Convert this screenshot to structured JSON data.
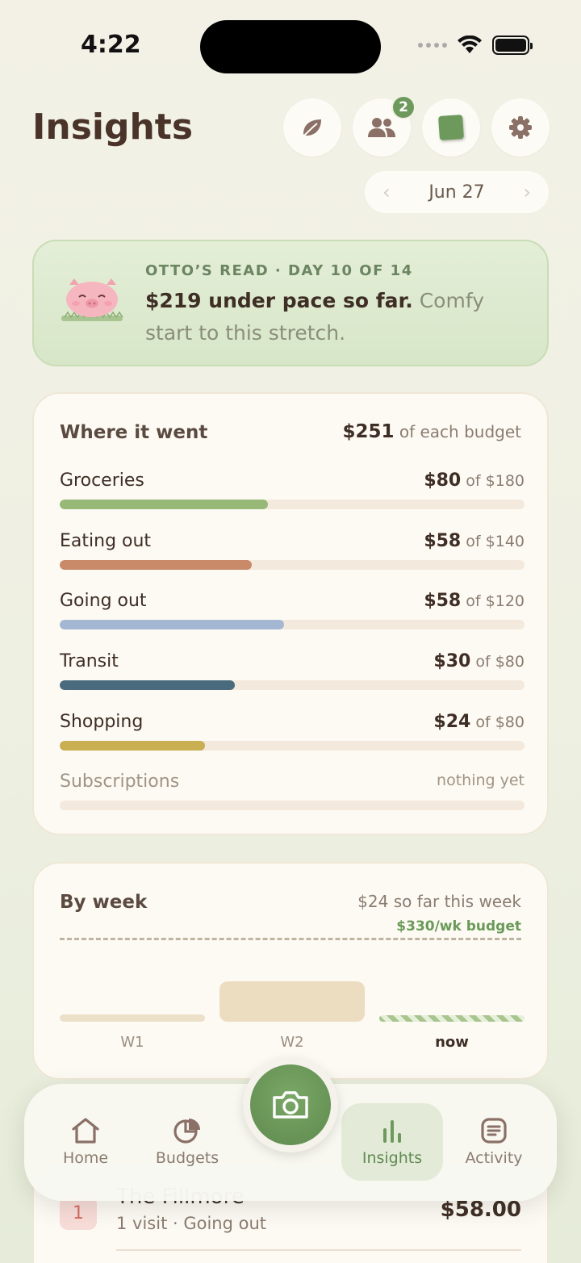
{
  "status": {
    "time": "4:22"
  },
  "header": {
    "title": "Insights",
    "friends_badge": "2"
  },
  "date_nav": {
    "date": "Jun 27",
    "prev": "‹",
    "next": "›"
  },
  "otto": {
    "label": "OTTO’S READ · DAY 10 OF 14",
    "headline": "$219 under pace so far.",
    "detail": " Comfy start to this stretch."
  },
  "where_it_went": {
    "title": "Where it went",
    "total": "$251",
    "total_suffix": " of each budget",
    "categories": [
      {
        "name": "Groceries",
        "spent": "$80",
        "of": " of $180",
        "fraction": 0.448,
        "color": "#97b877"
      },
      {
        "name": "Eating out",
        "spent": "$58",
        "of": " of $140",
        "fraction": 0.413,
        "color": "#c98a6a"
      },
      {
        "name": "Going out",
        "spent": "$58",
        "of": " of $120",
        "fraction": 0.483,
        "color": "#a3b7d3"
      },
      {
        "name": "Transit",
        "spent": "$30",
        "of": " of $80",
        "fraction": 0.377,
        "color": "#4a6a7e"
      },
      {
        "name": "Shopping",
        "spent": "$24",
        "of": " of $80",
        "fraction": 0.313,
        "color": "#c9ae52"
      },
      {
        "name": "Subscriptions",
        "empty": "nothing yet"
      }
    ]
  },
  "by_week": {
    "title": "By week",
    "this_week": "$24 so far this week",
    "budget_label": "$330/wk budget",
    "weeks": [
      {
        "label": "W1",
        "fraction_of_budget": 0.03
      },
      {
        "label": "W2",
        "fraction_of_budget": 0.17
      },
      {
        "label": "now",
        "fraction_of_budget": 0.02
      }
    ]
  },
  "list_item": {
    "rank": "1",
    "title": "The Fillmore",
    "subtitle": "1 visit · Going out",
    "amount": "$58.00"
  },
  "tabs": [
    {
      "label": "Home",
      "icon": "home-icon"
    },
    {
      "label": "Budgets",
      "icon": "pie-chart-icon"
    },
    {
      "label": "Insights",
      "icon": "bar-chart-icon"
    },
    {
      "label": "Activity",
      "icon": "list-icon"
    }
  ]
}
